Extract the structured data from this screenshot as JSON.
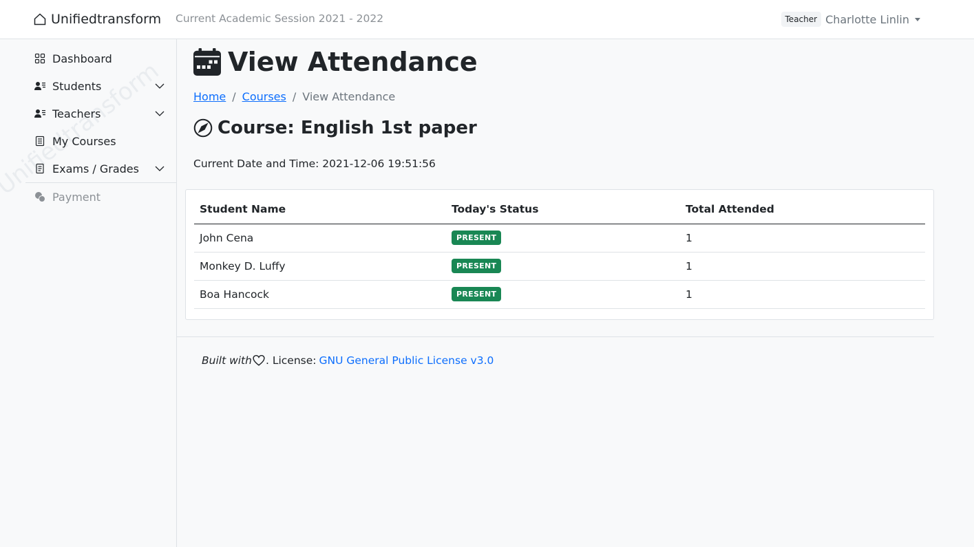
{
  "header": {
    "brand": "Unifiedtransform",
    "session": "Current Academic Session 2021 - 2022",
    "role": "Teacher",
    "user_name": "Charlotte Linlin"
  },
  "sidebar": {
    "items": [
      {
        "label": "Dashboard",
        "icon": "grid-icon"
      },
      {
        "label": "Students",
        "icon": "person-lines-icon",
        "expandable": true
      },
      {
        "label": "Teachers",
        "icon": "person-lines-icon",
        "expandable": true
      },
      {
        "label": "My Courses",
        "icon": "journal-icon"
      },
      {
        "label": "Exams / Grades",
        "icon": "file-text-icon",
        "expandable": true
      },
      {
        "label": "Payment",
        "icon": "coin-icon",
        "disabled": true
      }
    ],
    "watermark": "Unifiedtransform"
  },
  "main": {
    "title": "View Attendance",
    "breadcrumb": {
      "home": "Home",
      "courses": "Courses",
      "current": "View Attendance"
    },
    "course_title": "Course: English 1st paper",
    "datetime": "Current Date and Time: 2021-12-06 19:51:56",
    "table": {
      "headers": [
        "Student Name",
        "Today's Status",
        "Total Attended"
      ],
      "rows": [
        {
          "name": "John Cena",
          "status": "PRESENT",
          "total": "1"
        },
        {
          "name": "Monkey D. Luffy",
          "status": "PRESENT",
          "total": "1"
        },
        {
          "name": "Boa Hancock",
          "status": "PRESENT",
          "total": "1"
        }
      ]
    }
  },
  "footer": {
    "built_with": "Built with",
    "license_prefix": ". License:",
    "license_link": "GNU General Public License v3.0"
  },
  "colors": {
    "link": "#0d6efd",
    "badge_success": "#198754",
    "background": "#f8f9fa"
  }
}
